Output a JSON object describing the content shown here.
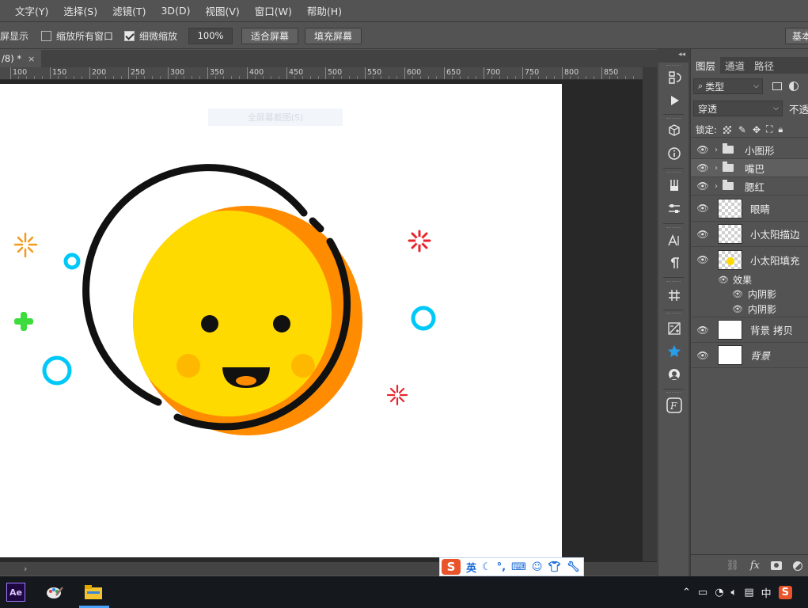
{
  "menu": [
    "文字(Y)",
    "选择(S)",
    "滤镜(T)",
    "3D(D)",
    "视图(V)",
    "窗口(W)",
    "帮助(H)"
  ],
  "options": {
    "fullscreen_partial": "屏显示",
    "zoom_all_windows": "缩放所有窗口",
    "zoom_all_checked": false,
    "scrubby_zoom": "细微缩放",
    "scrubby_checked": true,
    "zoom_value": "100%",
    "fit_screen": "适合屏幕",
    "fill_screen": "填充屏幕",
    "workspace": "基本"
  },
  "doc_tab": {
    "title": "/8) *",
    "close": "×"
  },
  "ruler_labels": [
    "100",
    "150",
    "200",
    "250",
    "300",
    "350",
    "400",
    "450",
    "500",
    "550",
    "600",
    "650",
    "700",
    "750",
    "800",
    "850"
  ],
  "canvas": {
    "ghost_text": "全屏幕截图(S)"
  },
  "colors": {
    "sun_yellow": "#FFDA00",
    "sun_orange": "#FF8C00",
    "outline": "#111111",
    "cyan": "#00C8F8",
    "green": "#3DDC3D",
    "red": "#E8242D",
    "spark_orange": "#F39A1E"
  },
  "layers_panel": {
    "tabs": [
      "图层",
      "通道",
      "路径"
    ],
    "filter": "类型",
    "blend_mode": "穿透",
    "opacity_label": "不透",
    "lock_label": "锁定:",
    "layers": [
      {
        "name": "小图形",
        "kind": "group",
        "selected": false
      },
      {
        "name": "嘴巴",
        "kind": "group",
        "selected": true
      },
      {
        "name": "腮红",
        "kind": "group",
        "selected": false
      },
      {
        "name": "眼睛",
        "kind": "shape",
        "selected": false
      },
      {
        "name": "小太阳描边",
        "kind": "shape",
        "selected": false
      },
      {
        "name": "小太阳填充",
        "kind": "shape",
        "selected": false
      },
      {
        "name": "背景 拷贝",
        "kind": "pixel",
        "selected": false
      },
      {
        "name": "背景",
        "kind": "pixel",
        "selected": false
      }
    ],
    "effects_label": "效果",
    "effects": [
      "内阴影",
      "内阴影"
    ],
    "footer": [
      "link-icon",
      "fx",
      "mask-icon",
      "adjustment-icon"
    ]
  },
  "ime": {
    "lang": "英"
  },
  "taskbar": {
    "apps": [
      "after-effects-icon",
      "paint-icon",
      "file-explorer-icon"
    ],
    "ime_indicator": "中"
  }
}
